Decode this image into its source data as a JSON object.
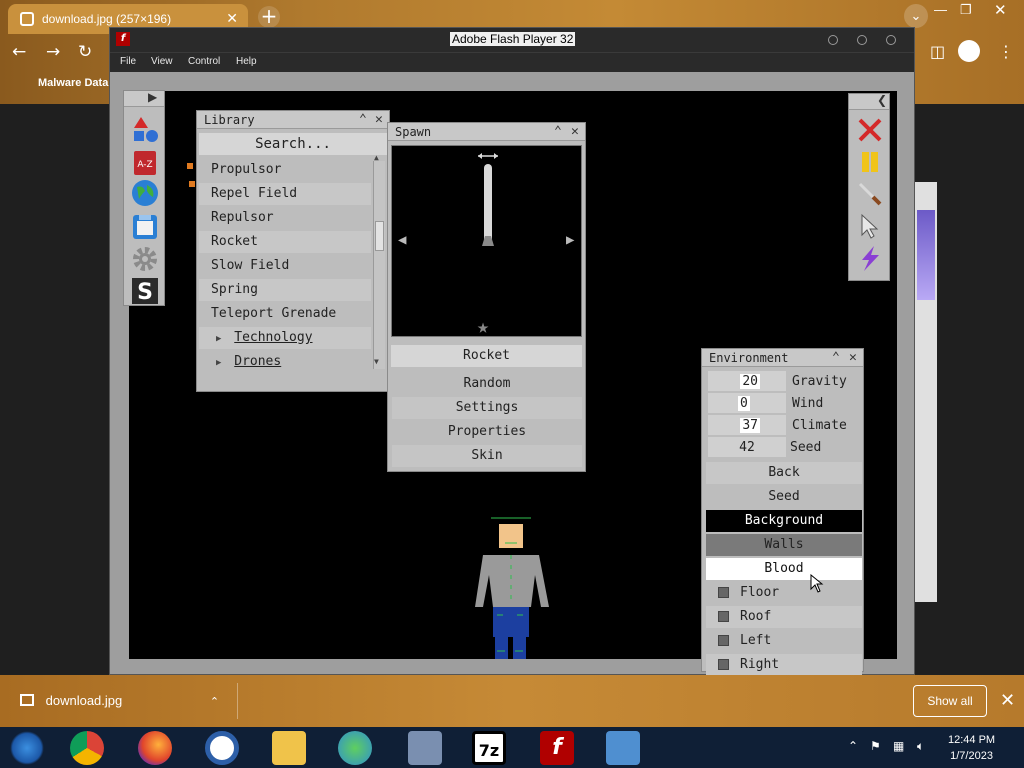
{
  "browser": {
    "tab_title": "download.jpg (257×196)",
    "bookmark": "Malware Data",
    "new_tab": "+",
    "tab_close": "✕"
  },
  "flash": {
    "window_title": "Adobe Flash Player 32",
    "menu": [
      "File",
      "View",
      "Control",
      "Help"
    ]
  },
  "library": {
    "title": "Library",
    "search_placeholder": "Search...",
    "items": [
      "Propulsor",
      "Repel Field",
      "Repulsor",
      "Rocket",
      "Slow Field",
      "Spring",
      "Teleport Grenade"
    ],
    "groups": [
      "Technology",
      "Drones"
    ]
  },
  "spawn": {
    "title": "Spawn",
    "selected": "Rocket",
    "buttons": [
      "Random",
      "Settings",
      "Properties",
      "Skin"
    ]
  },
  "environment": {
    "title": "Environment",
    "fields": [
      {
        "value": "20",
        "label": "Gravity"
      },
      {
        "value": "0",
        "label": "Wind"
      },
      {
        "value": "37",
        "label": "Climate"
      },
      {
        "value": "42",
        "label": "Seed"
      }
    ],
    "buttons": [
      "Back",
      "Seed",
      "Background",
      "Walls",
      "Blood"
    ],
    "checkboxes": [
      "Floor",
      "Roof",
      "Left",
      "Right"
    ]
  },
  "download": {
    "filename": "download.jpg",
    "show_all": "Show all"
  },
  "taskbar": {
    "time": "12:44 PM",
    "date": "1/7/2023"
  },
  "colors": {
    "panel_bg": "#bdbdbd",
    "stage_bg": "#000000",
    "chrome_accent": "#c48a35"
  }
}
